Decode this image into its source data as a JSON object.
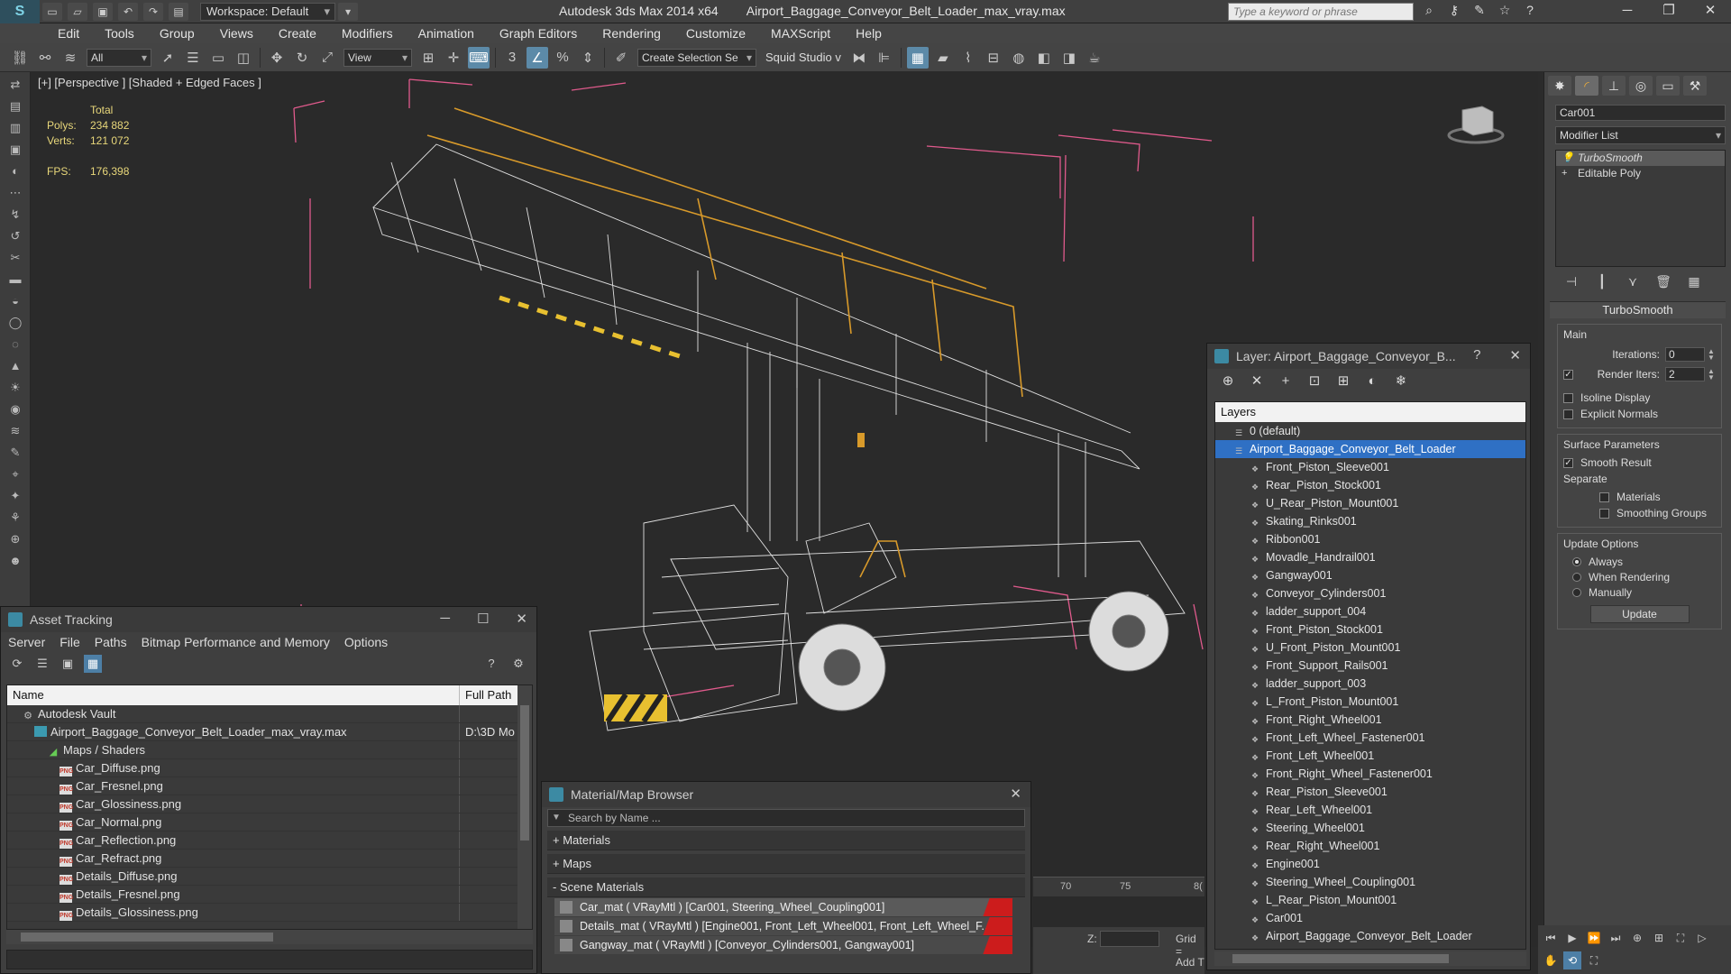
{
  "titlebar": {
    "workspace": "Workspace: Default",
    "app": "Autodesk 3ds Max  2014 x64",
    "file": "Airport_Baggage_Conveyor_Belt_Loader_max_vray.max",
    "search_placeholder": "Type a keyword or phrase"
  },
  "menu": [
    "Edit",
    "Tools",
    "Group",
    "Views",
    "Create",
    "Modifiers",
    "Animation",
    "Graph Editors",
    "Rendering",
    "Customize",
    "MAXScript",
    "Help"
  ],
  "toolbar": {
    "selection_filter": "All",
    "ref_coord": "View",
    "named_selection": "Create Selection Se",
    "squid": "Squid Studio v"
  },
  "viewport": {
    "label": "[+] [Perspective ] [Shaded + Edged Faces ]",
    "stats": {
      "total_label": "Total",
      "polys_label": "Polys:",
      "polys": "234 882",
      "verts_label": "Verts:",
      "verts": "121 072",
      "fps_label": "FPS:",
      "fps": "176,398"
    },
    "colors": {
      "stats": "#e8d77a",
      "wire": "#ffffff",
      "handrail": "#d89a2a",
      "bbox": "#e05a8c"
    }
  },
  "command_panel": {
    "object_name": "Car001",
    "modifier_list": "Modifier List",
    "stack": [
      "TurboSmooth",
      "Editable Poly"
    ],
    "rollout_title": "TurboSmooth",
    "main_label": "Main",
    "iterations_label": "Iterations:",
    "iterations": "0",
    "render_iters_label": "Render Iters:",
    "render_iters": "2",
    "isoline": "Isoline Display",
    "explicit_normals": "Explicit Normals",
    "surface_params": "Surface Parameters",
    "smooth_result": "Smooth Result",
    "separate": "Separate",
    "materials": "Materials",
    "smoothing_groups": "Smoothing Groups",
    "update_options": "Update Options",
    "always": "Always",
    "when_rendering": "When Rendering",
    "manually": "Manually",
    "update_btn": "Update"
  },
  "asset_tracking": {
    "title": "Asset Tracking",
    "menu": [
      "Server",
      "File",
      "Paths",
      "Bitmap Performance and Memory",
      "Options"
    ],
    "col_name": "Name",
    "col_path": "Full Path",
    "rows": [
      {
        "name": "Autodesk Vault",
        "path": "",
        "type": "vault",
        "indent": 1
      },
      {
        "name": "Airport_Baggage_Conveyor_Belt_Loader_max_vray.max",
        "path": "D:\\3D Mo",
        "type": "max",
        "indent": 2
      },
      {
        "name": "Maps / Shaders",
        "path": "",
        "type": "maps",
        "indent": 3
      },
      {
        "name": "Car_Diffuse.png",
        "path": "",
        "type": "png",
        "indent": 4
      },
      {
        "name": "Car_Fresnel.png",
        "path": "",
        "type": "png",
        "indent": 4
      },
      {
        "name": "Car_Glossiness.png",
        "path": "",
        "type": "png",
        "indent": 4
      },
      {
        "name": "Car_Normal.png",
        "path": "",
        "type": "png",
        "indent": 4
      },
      {
        "name": "Car_Reflection.png",
        "path": "",
        "type": "png",
        "indent": 4
      },
      {
        "name": "Car_Refract.png",
        "path": "",
        "type": "png",
        "indent": 4
      },
      {
        "name": "Details_Diffuse.png",
        "path": "",
        "type": "png",
        "indent": 4
      },
      {
        "name": "Details_Fresnel.png",
        "path": "",
        "type": "png",
        "indent": 4
      },
      {
        "name": "Details_Glossiness.png",
        "path": "",
        "type": "png",
        "indent": 4
      }
    ]
  },
  "material_browser": {
    "title": "Material/Map Browser",
    "search": "Search by Name ...",
    "sections": [
      "+ Materials",
      "+ Maps",
      "- Scene Materials"
    ],
    "materials": [
      "Car_mat  ( VRayMtl )  [Car001, Steering_Wheel_Coupling001]",
      "Details_mat  ( VRayMtl )  [Engine001, Front_Left_Wheel001, Front_Left_Wheel_F...",
      "Gangway_mat  ( VRayMtl )  [Conveyor_Cylinders001, Gangway001]"
    ]
  },
  "layer_explorer": {
    "title": "Layer: Airport_Baggage_Conveyor_B...",
    "help": "?",
    "header": "Layers",
    "default_layer": "0 (default)",
    "selected_layer": "Airport_Baggage_Conveyor_Belt_Loader",
    "objects": [
      "Front_Piston_Sleeve001",
      "Rear_Piston_Stock001",
      "U_Rear_Piston_Mount001",
      "Skating_Rinks001",
      "Ribbon001",
      "Movadle_Handrail001",
      "Gangway001",
      "Conveyor_Cylinders001",
      "ladder_support_004",
      "Front_Piston_Stock001",
      "U_Front_Piston_Mount001",
      "Front_Support_Rails001",
      "ladder_support_003",
      "L_Front_Piston_Mount001",
      "Front_Right_Wheel001",
      "Front_Left_Wheel_Fastener001",
      "Front_Left_Wheel001",
      "Front_Right_Wheel_Fastener001",
      "Rear_Piston_Sleeve001",
      "Rear_Left_Wheel001",
      "Steering_Wheel001",
      "Rear_Right_Wheel001",
      "Engine001",
      "Steering_Wheel_Coupling001",
      "L_Rear_Piston_Mount001",
      "Car001",
      "Airport_Baggage_Conveyor_Belt_Loader"
    ]
  },
  "timeline": {
    "t70": "70",
    "t75": "75",
    "t80": "8("
  },
  "coords": {
    "z": "Z:",
    "grid": "Grid =",
    "add_time_tag": "Add T"
  }
}
